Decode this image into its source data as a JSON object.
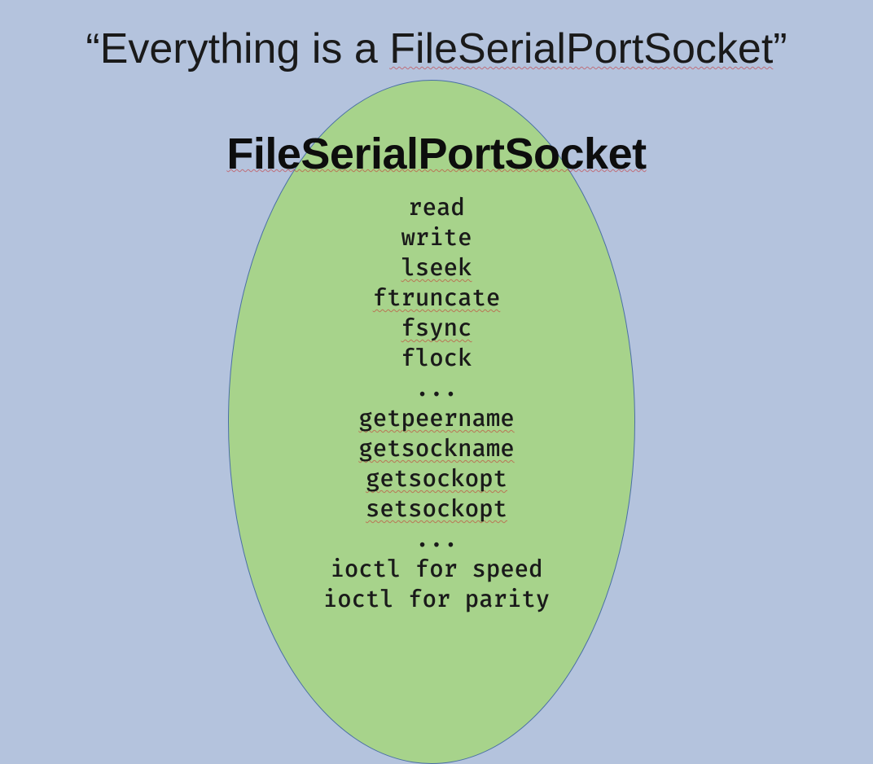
{
  "title_prefix": "“Everything is a ",
  "title_word": "FileSerialPortSocket",
  "title_suffix": "”",
  "class_name": "FileSerialPortSocket",
  "methods": [
    {
      "text": "read",
      "squiggle": false
    },
    {
      "text": "write",
      "squiggle": false
    },
    {
      "text": "lseek",
      "squiggle": true
    },
    {
      "text": "ftruncate",
      "squiggle": true
    },
    {
      "text": "fsync",
      "squiggle": true
    },
    {
      "text": "flock",
      "squiggle": false
    },
    {
      "text": "...",
      "squiggle": false
    },
    {
      "text": "getpeername",
      "squiggle": true
    },
    {
      "text": "getsockname",
      "squiggle": true
    },
    {
      "text": "getsockopt",
      "squiggle": true
    },
    {
      "text": "setsockopt",
      "squiggle": true
    },
    {
      "text": "...",
      "squiggle": false
    },
    {
      "text": "ioctl for speed",
      "squiggle": false
    },
    {
      "text": "ioctl for parity",
      "squiggle": false
    }
  ]
}
